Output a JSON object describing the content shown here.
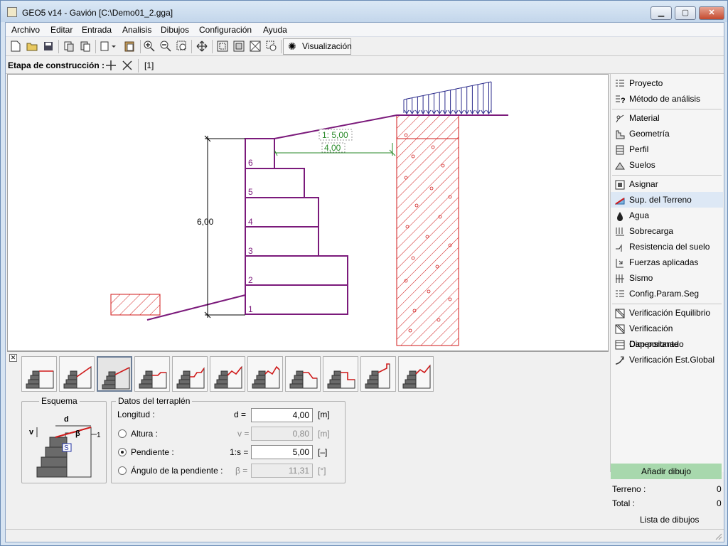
{
  "window": {
    "title": "GEO5 v14 - Gavión [C:\\Demo01_2.gga]",
    "min": "▁",
    "max": "▢",
    "close": "✕"
  },
  "menu": [
    "Archivo",
    "Editar",
    "Entrada",
    "Analisis",
    "Dibujos",
    "Configuración",
    "Ayuda"
  ],
  "toolbar": {
    "visualize": "Visualización"
  },
  "stage": {
    "label": "Etapa de construcción :",
    "current": "[1]"
  },
  "drawing": {
    "height_dim": "6,00",
    "slope_label": "1: 5,00",
    "length_label": "4,00",
    "blocks": [
      "1",
      "2",
      "3",
      "4",
      "5",
      "6"
    ]
  },
  "sidebar": {
    "items": [
      "Proyecto",
      "Método de análisis",
      "Material",
      "Geometría",
      "Perfil",
      "Suelos",
      "Asignar",
      "Sup. del Terreno",
      "Agua",
      "Sobrecarga",
      "Resistencia del suelo",
      "Fuerzas aplicadas",
      "Sismo",
      "Config.Param.Seg",
      "Verificación Equilibrio",
      "Verificación Cap.portante",
      "Dimensionado",
      "Verificación Est.Global"
    ],
    "active": "Sup. del Terreno"
  },
  "scheme": {
    "title": "Esquema",
    "d": "d",
    "v": "v",
    "beta": "β",
    "s": "S",
    "one": "1"
  },
  "embankment": {
    "title": "Datos del terraplén",
    "length": {
      "label": "Longitud :",
      "symbol": "d =",
      "value": "4,00",
      "unit": "[m]"
    },
    "height": {
      "label": "Altura :",
      "symbol": "v =",
      "value": "0,80",
      "unit": "[m]"
    },
    "slope": {
      "label": "Pendiente :",
      "symbol": "1:s =",
      "value": "5,00",
      "unit": "[–]"
    },
    "angle": {
      "label": "Ángulo de la pendiente :",
      "symbol": "β =",
      "value": "11,31",
      "unit": "[°]"
    },
    "selected": "slope"
  },
  "drawings_panel": {
    "add_button": "Añadir dibujo",
    "terrain_label": "Terreno :",
    "terrain_count": "0",
    "total_label": "Total :",
    "total_count": "0",
    "list_label": "Lista de dibujos"
  },
  "colors": {
    "wall": "#7b1a7b",
    "hatch": "#d01a1a",
    "dimension": "#2a8a2a",
    "load": "#2c2c8c",
    "accent_button": "#a8d8ad"
  }
}
